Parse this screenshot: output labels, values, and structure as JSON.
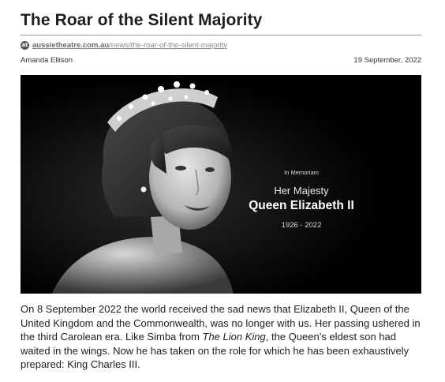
{
  "article": {
    "title": "The Roar of the Silent Majority",
    "source_domain": "aussietheatre.com.au",
    "source_path": "/news/the-roar-of-the-silent-majority",
    "source_icon": "aussie-theatre-logo-icon",
    "author": "Amanda Ellison",
    "date": "19 September, 2022"
  },
  "image": {
    "kicker": "In Memoriam",
    "line1": "Her Majesty",
    "line2": "Queen Elizabeth II",
    "years": "1926 - 2022"
  },
  "body": {
    "p1_a": "On 8 September 2022 the world received the sad news that Elizabeth II, Queen of the United Kingdom and the Commonwealth, was no longer with us. Her passing ushered in the third Carolean era. Like Simba from ",
    "p1_em": "The Lion King",
    "p1_b": ", the Queen’s eldest son had waited in the wings. Now he has taken on the role for which he has been exhaustively prepared: King Charles III."
  }
}
